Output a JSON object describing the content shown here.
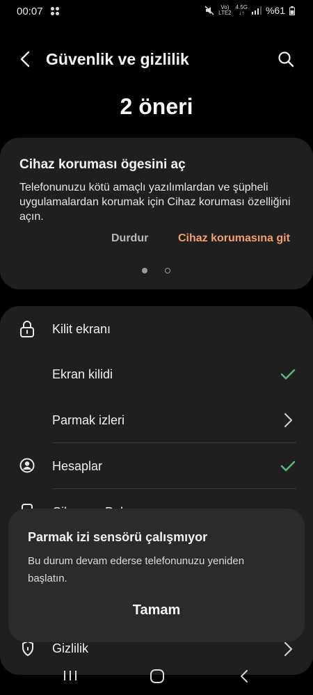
{
  "status_bar": {
    "time": "00:07",
    "network": "LTE2",
    "signal_label": "4.5G",
    "battery": "%61"
  },
  "header": {
    "title": "Güvenlik ve gizlilik"
  },
  "suggestions": {
    "count_label": "2 öneri"
  },
  "card": {
    "title": "Cihaz koruması ögesini aç",
    "description": "Telefonunuzu kötü amaçlı yazılımlardan ve şüpheli uygulamalardan korumak için Cihaz koruması özelliğini açın.",
    "dismiss_label": "Durdur",
    "action_label": "Cihaz korumasına git"
  },
  "list": {
    "lock_screen": "Kilit ekranı",
    "screen_lock": "Ekran kilidi",
    "fingerprints": "Parmak izleri",
    "accounts": "Hesaplar",
    "partial_item": "Cihazımı Bul",
    "privacy": "Gizlilik"
  },
  "dialog": {
    "title": "Parmak izi sensörü çalışmıyor",
    "message": "Bu durum devam ederse telefonunuzu yeniden başlatın.",
    "ok_label": "Tamam"
  },
  "colors": {
    "accent": "#f5a06b",
    "check": "#57b87a"
  }
}
